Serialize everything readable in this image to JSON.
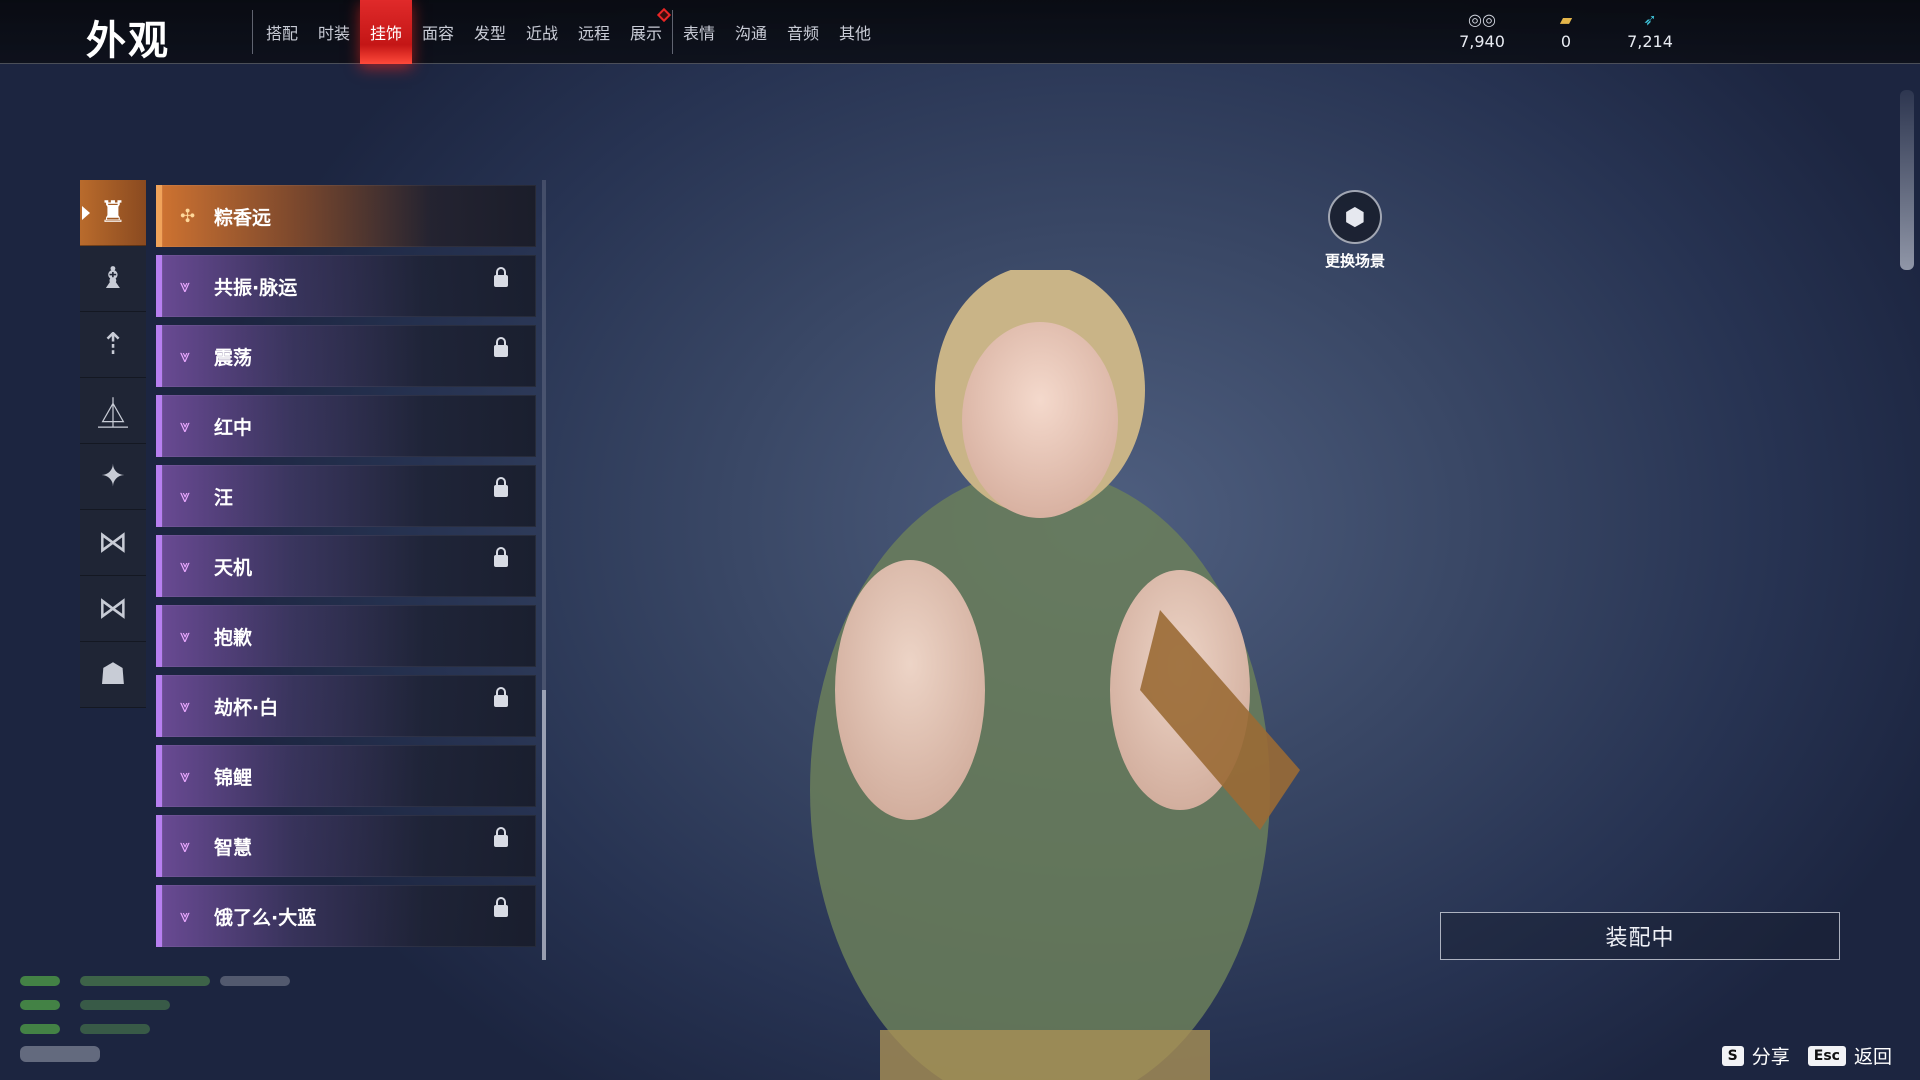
{
  "header": {
    "title": "外观",
    "tabs": [
      {
        "label": "搭配",
        "active": false
      },
      {
        "label": "时装",
        "active": false
      },
      {
        "label": "挂饰",
        "active": true
      },
      {
        "label": "面容",
        "active": false
      },
      {
        "label": "发型",
        "active": false
      },
      {
        "label": "近战",
        "active": false
      },
      {
        "label": "远程",
        "active": false
      },
      {
        "label": "展示",
        "active": false,
        "badge": true
      },
      {
        "label": "表情",
        "active": false
      },
      {
        "label": "沟通",
        "active": false
      },
      {
        "label": "音频",
        "active": false
      },
      {
        "label": "其他",
        "active": false
      }
    ]
  },
  "currencies": [
    {
      "icon": "silver-coin-icon",
      "value": "7,940"
    },
    {
      "icon": "gold-ticket-icon",
      "value": "0"
    },
    {
      "icon": "jade-feather-icon",
      "value": "7,214"
    }
  ],
  "categories": [
    {
      "icon": "helmet-ornament-icon",
      "active": true
    },
    {
      "icon": "back-ornament-icon",
      "active": false
    },
    {
      "icon": "waist-ornament-icon",
      "active": false
    },
    {
      "icon": "shoulder-ornament-icon",
      "active": false
    },
    {
      "icon": "body-effect-icon",
      "active": false
    },
    {
      "icon": "wing-ornament-icon",
      "active": false
    },
    {
      "icon": "wing-alt-icon",
      "active": false
    },
    {
      "icon": "mask-icon",
      "active": false
    }
  ],
  "items": [
    {
      "name": "粽香远",
      "selected": true,
      "locked": false,
      "quality_color": "#f0a35a"
    },
    {
      "name": "共振·脉运",
      "selected": false,
      "locked": true,
      "quality_color": "#b77ff0"
    },
    {
      "name": "震荡",
      "selected": false,
      "locked": true,
      "quality_color": "#b77ff0"
    },
    {
      "name": "红中",
      "selected": false,
      "locked": false,
      "quality_color": "#b77ff0"
    },
    {
      "name": "汪",
      "selected": false,
      "locked": true,
      "quality_color": "#b77ff0"
    },
    {
      "name": "天机",
      "selected": false,
      "locked": true,
      "quality_color": "#b77ff0"
    },
    {
      "name": "抱歉",
      "selected": false,
      "locked": false,
      "quality_color": "#b77ff0"
    },
    {
      "name": "劫杯·白",
      "selected": false,
      "locked": true,
      "quality_color": "#b77ff0"
    },
    {
      "name": "锦鲤",
      "selected": false,
      "locked": false,
      "quality_color": "#b77ff0"
    },
    {
      "name": "智慧",
      "selected": false,
      "locked": true,
      "quality_color": "#b77ff0"
    },
    {
      "name": "饿了么·大蓝",
      "selected": false,
      "locked": true,
      "quality_color": "#b77ff0"
    }
  ],
  "scene": {
    "label": "更换场景",
    "icon": "cube-icon"
  },
  "equip_button": {
    "label": "装配中"
  },
  "hints": [
    {
      "key": "S",
      "label": "分享"
    },
    {
      "key": "Esc",
      "label": "返回"
    }
  ],
  "colors": {
    "accent_red": "#e02a2a",
    "epic_purple": "#b77ff0",
    "legendary_orange": "#f0a35a"
  }
}
